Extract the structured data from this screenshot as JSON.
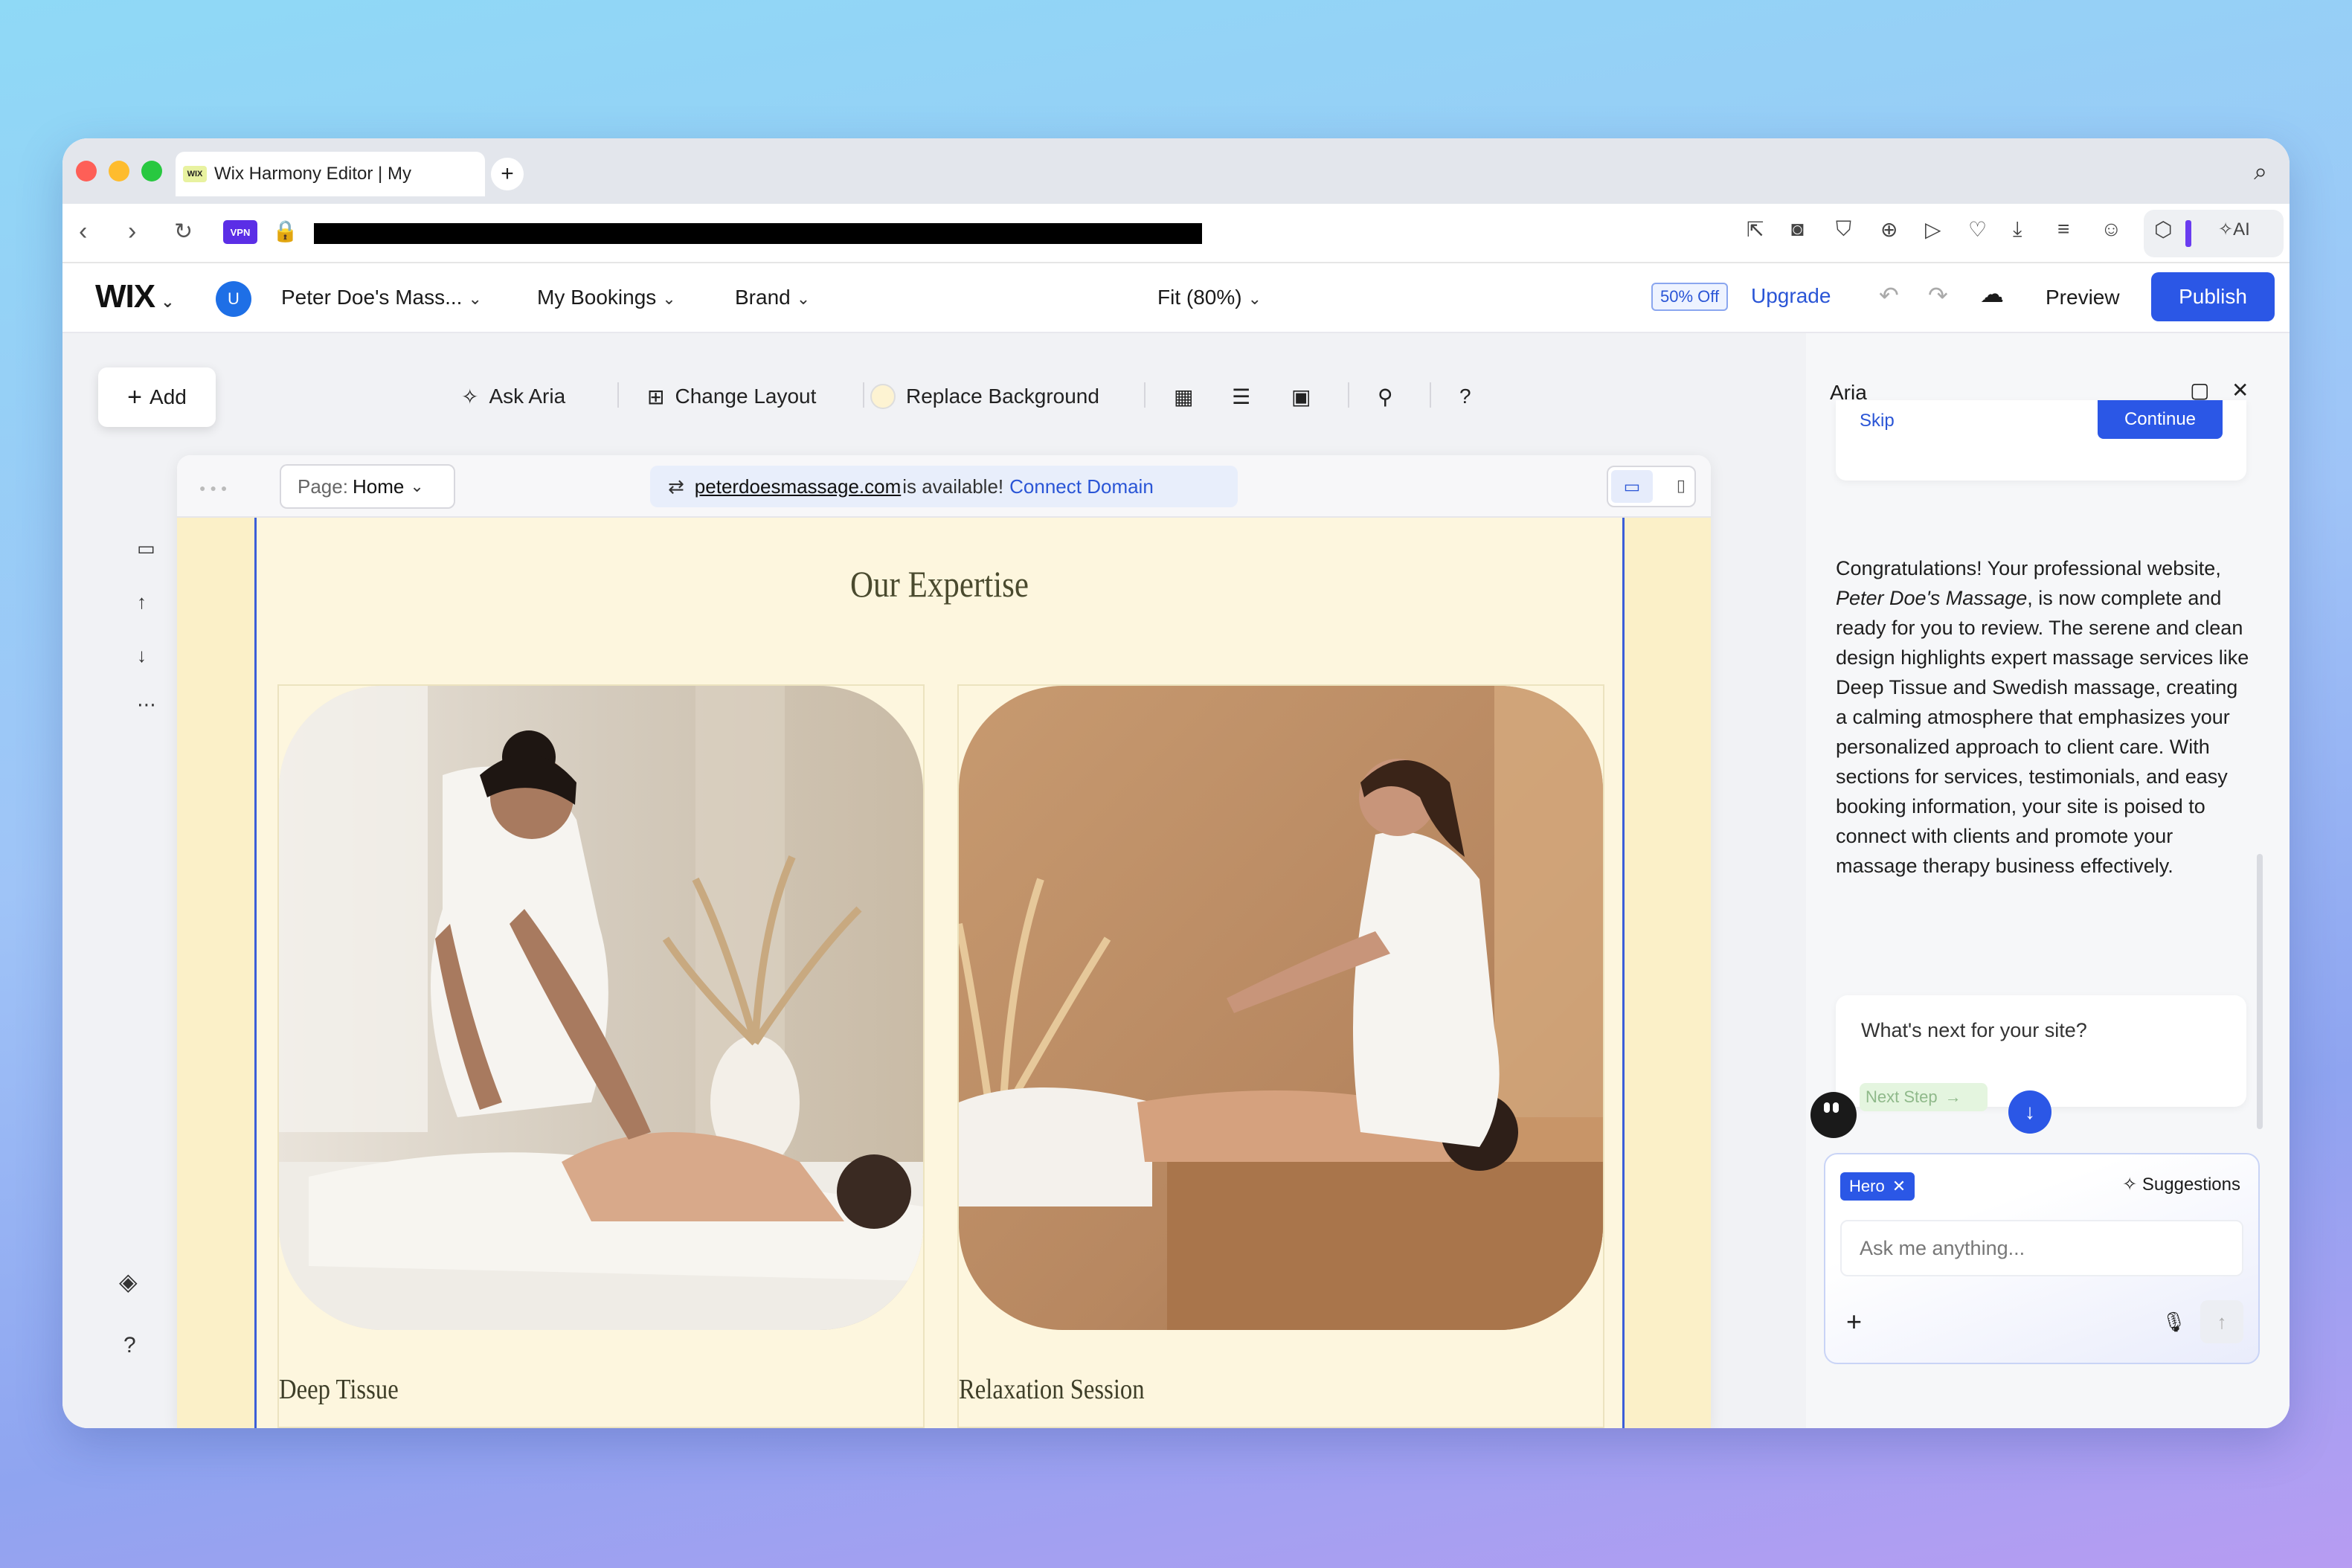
{
  "browser": {
    "tab_title": "Wix Harmony Editor | My",
    "favicon_text": "WIX",
    "new_tab": "+",
    "vpn_label": "VPN"
  },
  "editor": {
    "logo": "WIX",
    "avatar_letter": "U",
    "site_name": "Peter Doe's Mass...",
    "menu_bookings": "My Bookings",
    "menu_brand": "Brand",
    "zoom": "Fit (80%)",
    "discount_badge": "50% Off",
    "upgrade": "Upgrade",
    "preview": "Preview",
    "publish": "Publish"
  },
  "toolbar": {
    "add": "Add",
    "ask_aria": "Ask Aria",
    "change_layout": "Change Layout",
    "replace_background": "Replace Background",
    "help": "?"
  },
  "canvas": {
    "page_label": "Page:",
    "page_value": "Home",
    "domain": "peterdoesmassage.com",
    "domain_status": "is available!",
    "connect_domain": "Connect Domain"
  },
  "site": {
    "section_title": "Our Expertise",
    "cards": [
      {
        "label": "Deep Tissue"
      },
      {
        "label": "Relaxation Session"
      }
    ]
  },
  "aria": {
    "title": "Aria",
    "skip": "Skip",
    "continue": "Continue",
    "message_pre": "Congratulations! Your professional website, ",
    "message_site": "Peter Doe's Massage",
    "message_post": ", is now complete and ready for you to review. The serene and clean design highlights expert massage services like Deep Tissue and Swedish massage, creating a calming atmosphere that emphasizes your personalized approach to client care. With sections for services, testimonials, and easy booking information, your site is poised to connect with clients and promote your massage therapy business effectively.",
    "next_question": "What's next for your site?",
    "next_step": "Next Step",
    "chip": "Hero",
    "suggestions": "Suggestions",
    "input_placeholder": "Ask me anything..."
  },
  "colors": {
    "accent": "#2b57e6",
    "site_bg": "#fdf6de",
    "title_text": "#4a4a2e"
  }
}
